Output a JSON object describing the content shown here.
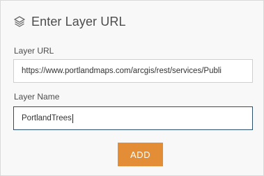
{
  "dialog": {
    "title": "Enter Layer URL",
    "icon": "layers-icon"
  },
  "layer_url": {
    "label": "Layer URL",
    "value": "https://www.portlandmaps.com/arcgis/rest/services/Publi"
  },
  "layer_name": {
    "label": "Layer Name",
    "value": "PortlandTrees"
  },
  "add_button": {
    "label": "ADD",
    "color": "#e38e36"
  }
}
